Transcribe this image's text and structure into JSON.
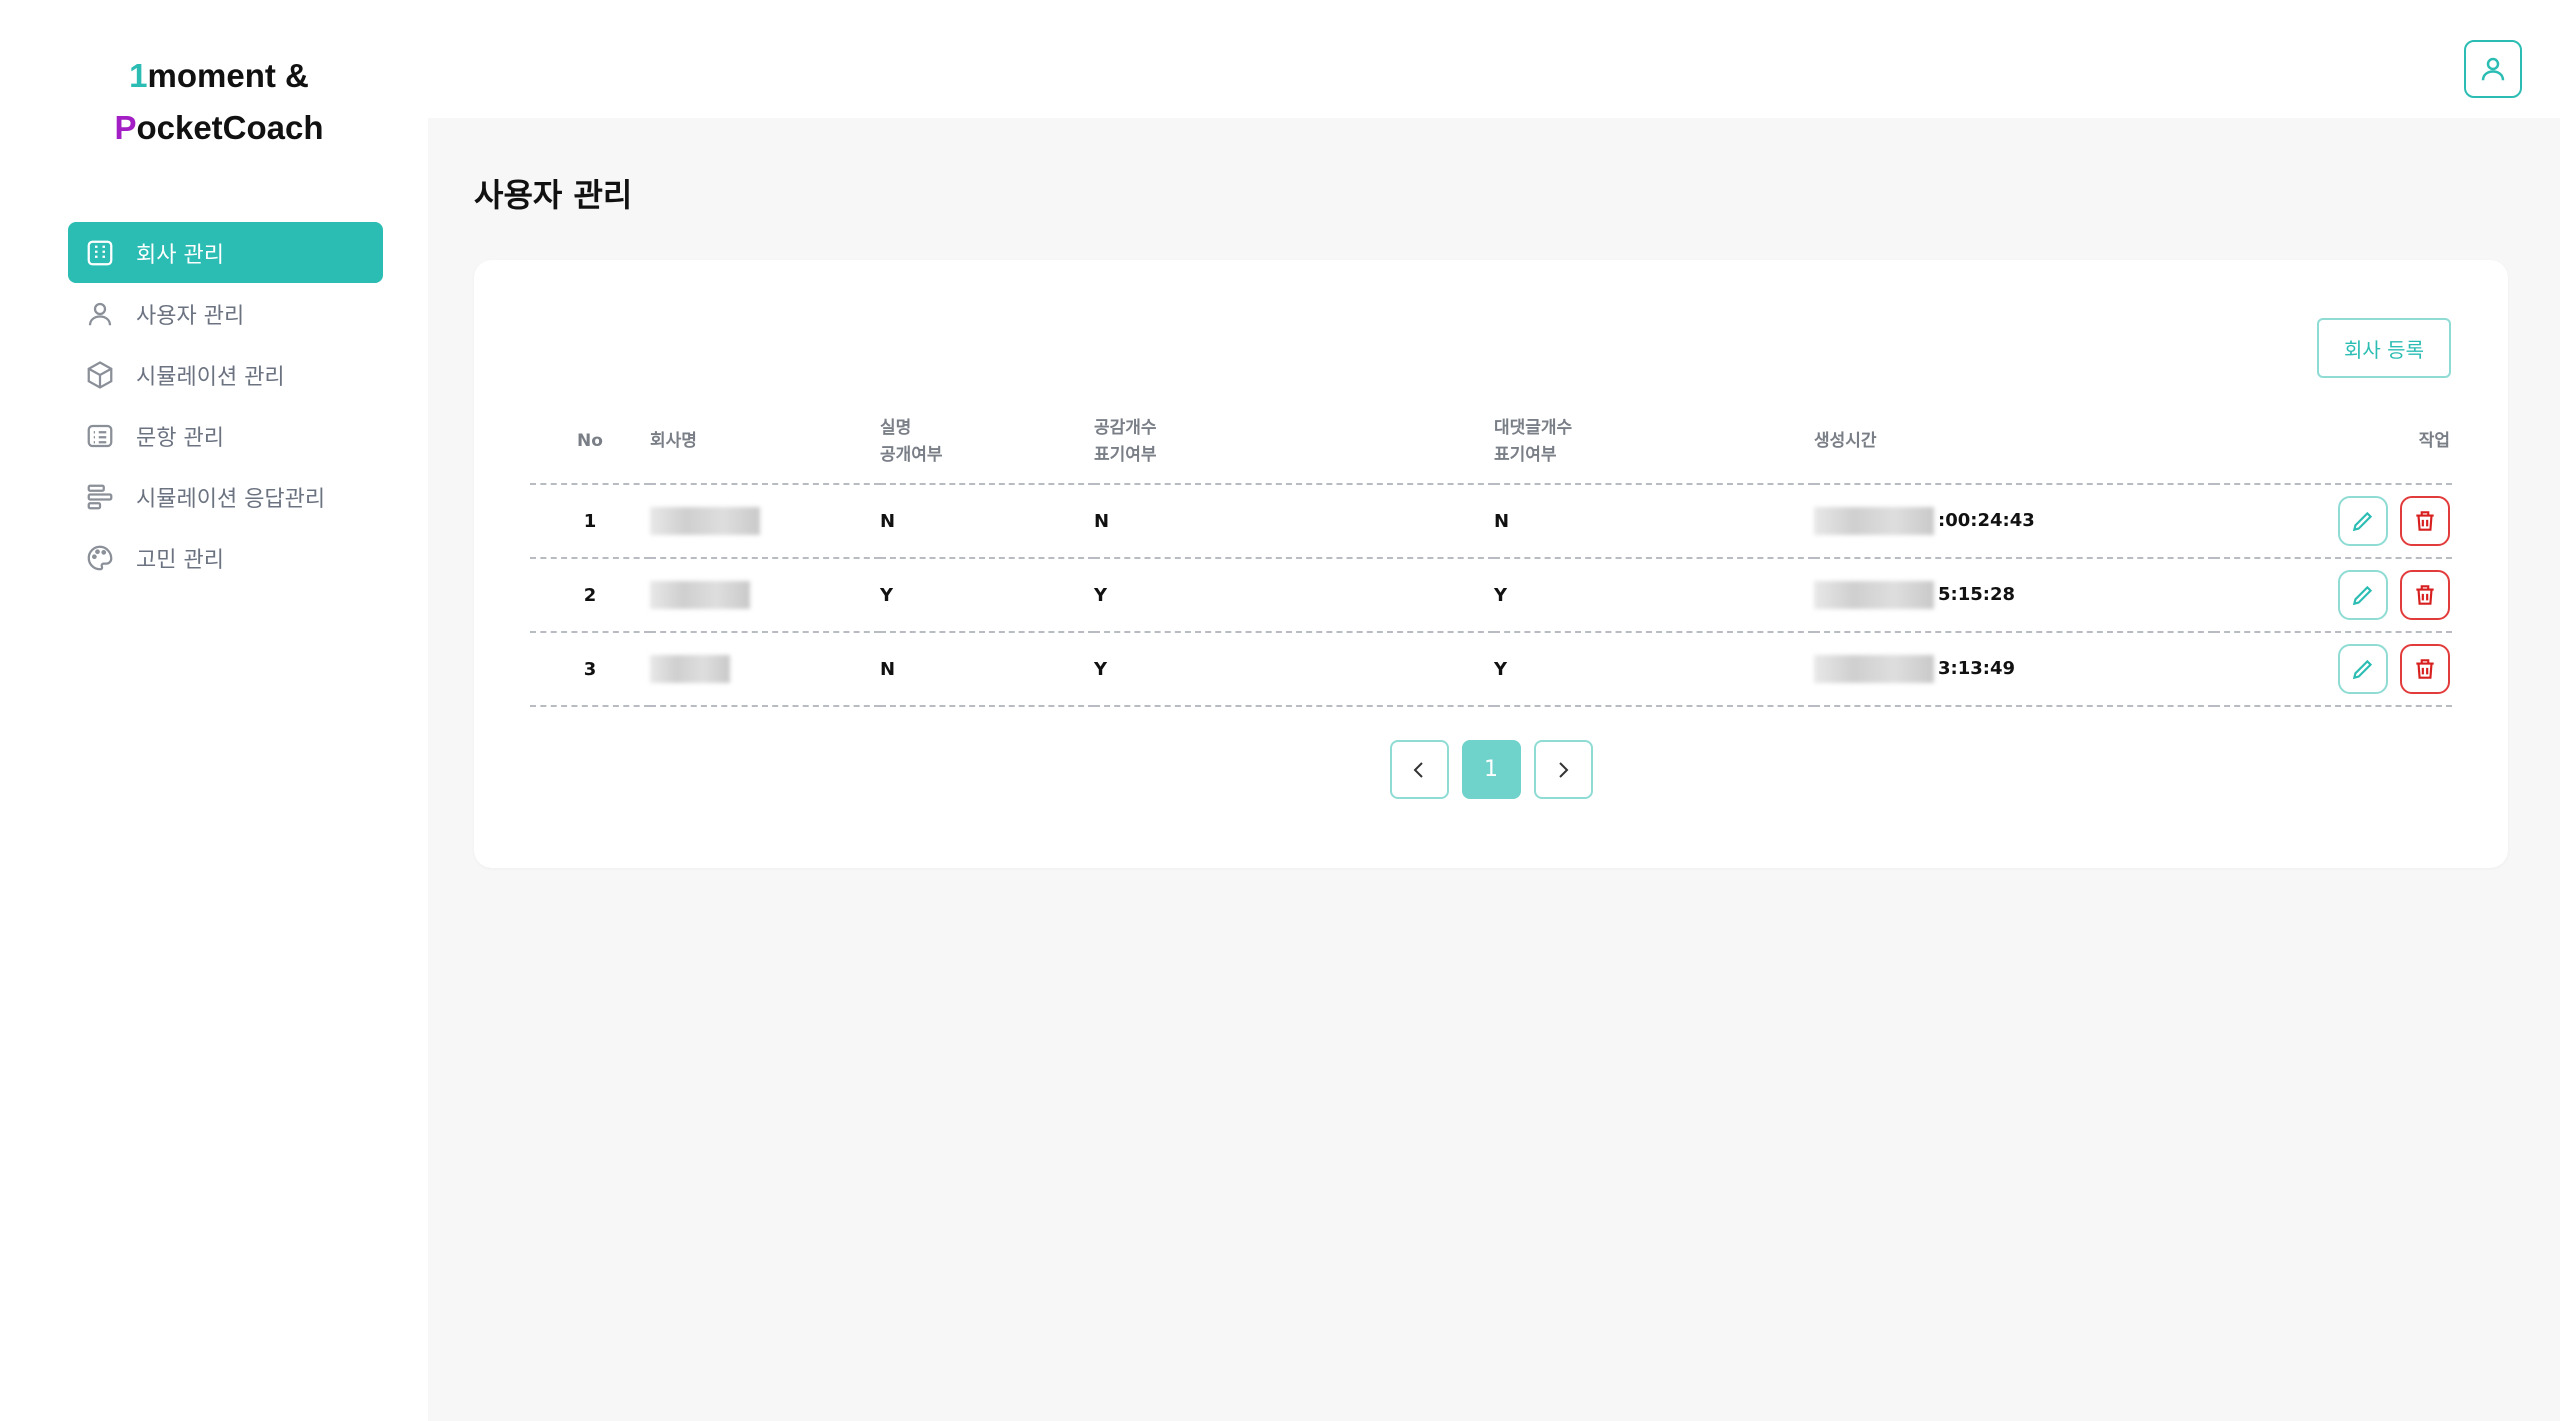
{
  "brand": {
    "line1_first": "1",
    "line1_rest": "moment &",
    "line2_first": "P",
    "line2_rest": "ocketCoach"
  },
  "sidebar": {
    "items": [
      {
        "label": "회사 관리",
        "icon": "building-icon",
        "active": true
      },
      {
        "label": "사용자 관리",
        "icon": "user-icon",
        "active": false
      },
      {
        "label": "시뮬레이션 관리",
        "icon": "cube-icon",
        "active": false
      },
      {
        "label": "문항 관리",
        "icon": "list-icon",
        "active": false
      },
      {
        "label": "시뮬레이션 응답관리",
        "icon": "bars-icon",
        "active": false
      },
      {
        "label": "고민 관리",
        "icon": "palette-icon",
        "active": false
      }
    ]
  },
  "page": {
    "title": "사용자 관리"
  },
  "card": {
    "add_button_label": "회사 등록",
    "table": {
      "headers": {
        "no": "No",
        "name": "회사명",
        "real_line1": "실명",
        "real_line2": "공개여부",
        "empathy_line1": "공감개수",
        "empathy_line2": "표기여부",
        "reply_line1": "대댓글개수",
        "reply_line2": "표기여부",
        "created": "생성시간",
        "actions": "작업"
      },
      "rows": [
        {
          "no": "1",
          "name": "",
          "real_name_public": "N",
          "empathy_count_shown": "N",
          "reply_count_shown": "N",
          "created_time_visible": ":00:24:43"
        },
        {
          "no": "2",
          "name": "",
          "real_name_public": "Y",
          "empathy_count_shown": "Y",
          "reply_count_shown": "Y",
          "created_time_visible": "5:15:28"
        },
        {
          "no": "3",
          "name": "",
          "real_name_public": "N",
          "empathy_count_shown": "Y",
          "reply_count_shown": "Y",
          "created_time_visible": "3:13:49"
        }
      ]
    },
    "pagination": {
      "current_page": "1"
    }
  },
  "colors": {
    "accent": "#2bbdb3",
    "danger": "#d81f1f",
    "brand_p": "#a31ec4"
  }
}
